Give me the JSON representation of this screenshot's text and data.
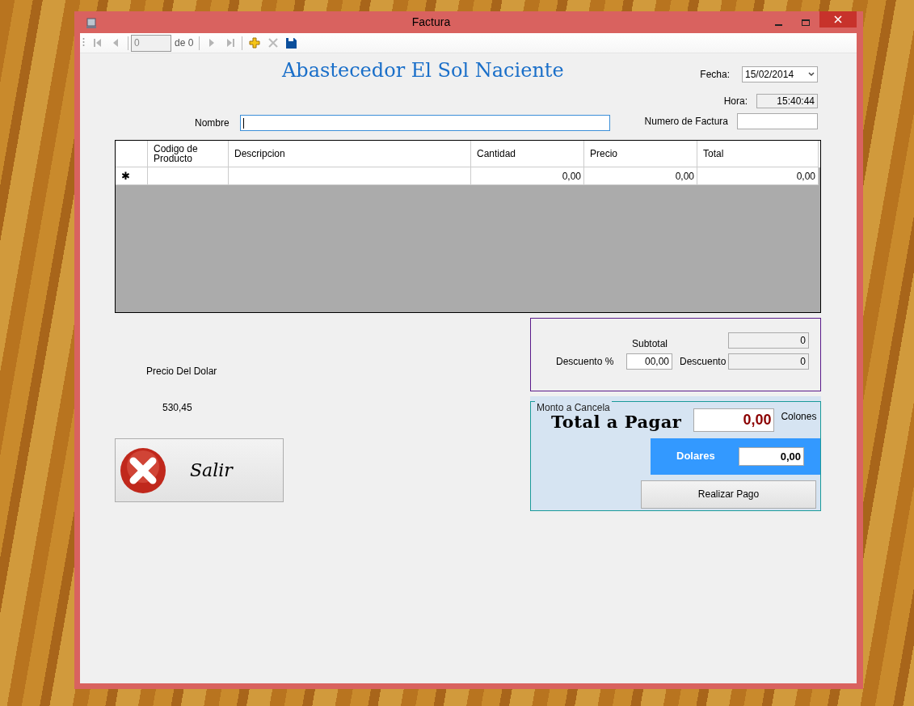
{
  "window": {
    "title": "Factura"
  },
  "toolbar": {
    "items": [
      {
        "kind": "first",
        "disabled": true
      },
      {
        "kind": "prev",
        "disabled": true
      },
      {
        "kind": "sep"
      },
      {
        "kind": "position",
        "value": "0",
        "disabled": true
      },
      {
        "kind": "count",
        "text": "de 0"
      },
      {
        "kind": "sep"
      },
      {
        "kind": "next",
        "disabled": true
      },
      {
        "kind": "last",
        "disabled": true
      },
      {
        "kind": "sep"
      },
      {
        "kind": "add",
        "disabled": false
      },
      {
        "kind": "delete",
        "disabled": true
      },
      {
        "kind": "save",
        "disabled": false
      }
    ]
  },
  "header": {
    "title": "Abastecedor El Sol Naciente",
    "nombre_label": "Nombre",
    "fecha_label": "Fecha:",
    "fecha_value": "15/02/2014",
    "hora_label": "Hora:",
    "hora_value": "15:40:44",
    "numero_label": "Numero de Factura"
  },
  "grid": {
    "columns": [
      "Codigo de Producto",
      "Descripcion",
      "Cantidad",
      "Precio",
      "Total"
    ],
    "new_row": {
      "marker": "✱",
      "cantidad": "0,00",
      "precio": "0,00",
      "total": "0,00"
    }
  },
  "dolar": {
    "label": "Precio Del Dolar",
    "value": "530,45"
  },
  "salir": {
    "label": "Salir"
  },
  "summary": {
    "subtotal_label": "Subtotal",
    "subtotal_value": "0",
    "descuento_pct_label": "Descuento %",
    "descuento_pct_value": "00,00",
    "descuento_label": "Descuento",
    "descuento_value": "0"
  },
  "monto": {
    "legend": "Monto a Cancela",
    "total_label": "Total a Pagar",
    "total_value": "0,00",
    "currency": "Colones",
    "dolares_label": "Dolares",
    "dolares_value": "0,00",
    "button": "Realizar Pago"
  }
}
